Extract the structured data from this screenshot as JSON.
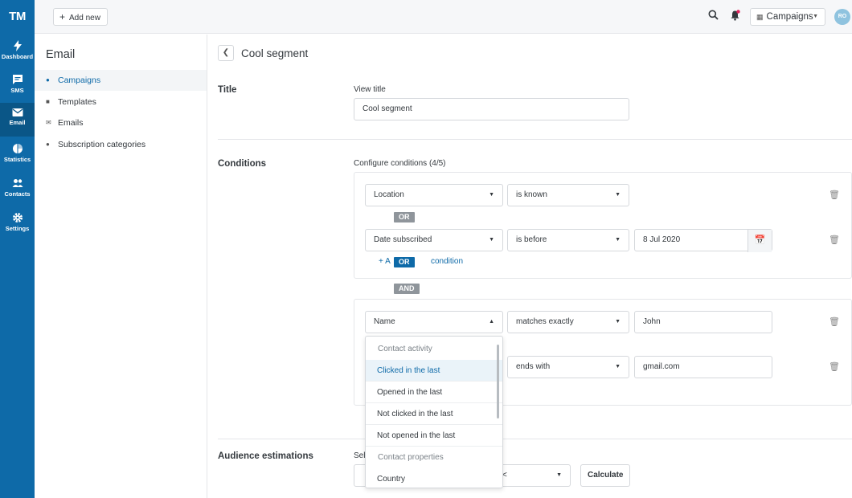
{
  "rail": {
    "logo": "TM",
    "items": [
      {
        "label": "Dashboard",
        "icon": "bolt-icon"
      },
      {
        "label": "SMS",
        "icon": "chat-icon"
      },
      {
        "label": "Email",
        "icon": "envelope-icon"
      },
      {
        "label": "Statistics",
        "icon": "pie-chart-icon"
      },
      {
        "label": "Contacts",
        "icon": "contacts-icon"
      },
      {
        "label": "Settings",
        "icon": "gear-icon"
      }
    ]
  },
  "topbar": {
    "add_new": "Add new",
    "campaigns_select": "Campaigns",
    "avatar_initials": "RO"
  },
  "sidebar": {
    "title": "Email",
    "items": [
      {
        "label": "Campaigns"
      },
      {
        "label": "Templates"
      },
      {
        "label": "Emails"
      },
      {
        "label": "Subscription categories"
      }
    ]
  },
  "main": {
    "page_title": "Cool segment",
    "title_section": {
      "label": "Title",
      "view_title_label": "View title",
      "view_title_value": "Cool segment"
    },
    "conditions_section": {
      "label": "Conditions",
      "configure_label": "Configure conditions (4/5)",
      "group1": {
        "row1": {
          "field": "Location",
          "operator": "is known"
        },
        "or_tag": "OR",
        "row2": {
          "field": "Date subscribed",
          "operator": "is before",
          "value": "8 Jul 2020"
        },
        "add_condition_plus": "+",
        "add_condition_a": "A",
        "add_condition_or_tag": "OR",
        "add_condition_text": "condition"
      },
      "and_tag": "AND",
      "group2": {
        "row1": {
          "field": "Name",
          "operator": "matches exactly",
          "value": "John"
        },
        "row2": {
          "operator": "ends with",
          "value": "gmail.com"
        }
      }
    },
    "dropdown": {
      "items": [
        {
          "label": "Contact activity",
          "type": "header"
        },
        {
          "label": "Clicked in the last",
          "type": "option"
        },
        {
          "label": "Opened in the last",
          "type": "option"
        },
        {
          "label": "Not clicked in the last",
          "type": "option"
        },
        {
          "label": "Not opened in the last",
          "type": "option"
        },
        {
          "label": "Contact properties",
          "type": "header"
        },
        {
          "label": "Country",
          "type": "option"
        }
      ]
    },
    "audience_section": {
      "label": "Audience estimations",
      "partial_label_left": "Sel",
      "partial_label_right": "t:",
      "select_partial": "<",
      "calculate": "Calculate"
    }
  }
}
